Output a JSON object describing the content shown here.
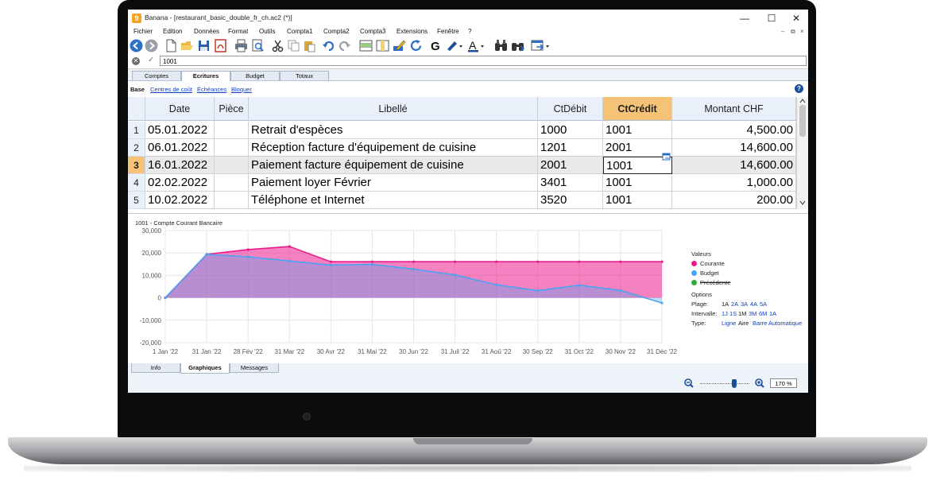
{
  "window": {
    "app_icon": "9",
    "title": "Banana - [restaurant_basic_double_fr_ch.ac2 (*)]",
    "minimize": "—",
    "maximize": "☐",
    "close": "✕"
  },
  "menu": [
    "Fichier",
    "Edition",
    "Données",
    "Format",
    "Outils",
    "Compta1",
    "Compta2",
    "Compta3",
    "Extensions",
    "Fenêtre",
    "?"
  ],
  "mdi_buttons": [
    "–",
    "⧉",
    "×"
  ],
  "toolbar": {
    "icons": [
      "back-icon",
      "forward-icon",
      "new-file-icon",
      "open-folder-icon",
      "save-icon",
      "pdf-icon",
      "print-icon",
      "print-preview-icon",
      "cut-icon",
      "copy-icon",
      "paste-icon",
      "undo-icon",
      "redo-icon",
      "insert-row-icon",
      "add-column-icon",
      "edit-pen-icon",
      "refresh-icon",
      "bold-icon",
      "highlight-color-icon",
      "font-color-icon",
      "find-icon",
      "replace-icon",
      "window-export-icon"
    ],
    "bold_label": "G",
    "font_color_label": "A"
  },
  "editbar": {
    "cancel": "✕",
    "confirm": "✓",
    "value": "1001"
  },
  "tabs": [
    "Comptes",
    "Ecritures",
    "Budget",
    "Totaux"
  ],
  "active_tab": "Ecritures",
  "views": {
    "base": "Base",
    "links": [
      "Centres de coût",
      "Échéances",
      "Bloquer"
    ]
  },
  "help": "?",
  "table": {
    "columns": [
      "Date",
      "Pièce",
      "Libellé",
      "CtDébit",
      "CtCrédit",
      "Montant CHF"
    ],
    "selected_column": "CtCrédit",
    "current_row": 3,
    "rows": [
      {
        "n": "1",
        "date": "05.01.2022",
        "piece": "",
        "libelle": "Retrait d'espèces",
        "debit": "1000",
        "credit": "1001",
        "montant": "4,500.00"
      },
      {
        "n": "2",
        "date": "06.01.2022",
        "piece": "",
        "libelle": "Réception facture d'équipement de cuisine",
        "debit": "1201",
        "credit": "2001",
        "montant": "14,600.00"
      },
      {
        "n": "3",
        "date": "16.01.2022",
        "piece": "",
        "libelle": "Paiement facture équipement de cuisine",
        "debit": "2001",
        "credit": "1001",
        "montant": "14,600.00"
      },
      {
        "n": "4",
        "date": "02.02.2022",
        "piece": "",
        "libelle": "Paiement loyer Février",
        "debit": "3401",
        "credit": "1001",
        "montant": "1,000.00"
      },
      {
        "n": "5",
        "date": "10.02.2022",
        "piece": "",
        "libelle": "Téléphone et Internet",
        "debit": "3520",
        "credit": "1001",
        "montant": "200.00"
      }
    ]
  },
  "chart_data": {
    "type": "area",
    "title": "1001 - Compte Courant Bancaire",
    "categories": [
      "1 Jan '22",
      "31 Jan '22",
      "28 Fév '22",
      "31 Mar '22",
      "30 Avr '22",
      "31 Mai '22",
      "30 Jun '22",
      "31 Juil '22",
      "31 Aoû '22",
      "30 Sep '22",
      "31 Oct '22",
      "30 Nov '22",
      "31 Déc '22"
    ],
    "ylim": [
      -20000,
      30000
    ],
    "yticks": [
      30000,
      20000,
      10000,
      0,
      -10000,
      -20000
    ],
    "ytick_labels": [
      "30,000",
      "20,000",
      "10,000",
      "0",
      "-10,000",
      "-20,000"
    ],
    "grid": true,
    "legend_position": "right",
    "series": [
      {
        "name": "Courante",
        "color": "#ec1b8c",
        "values": [
          0,
          19400,
          21500,
          22900,
          16100,
          16100,
          16100,
          16100,
          16100,
          16100,
          16100,
          16100,
          16100
        ]
      },
      {
        "name": "Budget",
        "color": "#4aa3f0",
        "values": [
          0,
          19400,
          18300,
          16400,
          14600,
          14900,
          12800,
          10200,
          5800,
          3200,
          5600,
          3300,
          -2300
        ]
      },
      {
        "name": "Précédente",
        "color": "#2eaa3a",
        "values": [],
        "struck": true
      }
    ]
  },
  "chart_panel": {
    "legend_title": "Valeurs",
    "options_title": "Options",
    "plage_label": "Plage:",
    "plage_values": [
      "1A",
      "2A",
      "3A",
      "4A",
      "5A"
    ],
    "intervalle_label": "Intervalle:",
    "intervalle_values": [
      "1J",
      "1S",
      "1M",
      "3M",
      "6M",
      "1A"
    ],
    "type_label": "Type:",
    "type_values": [
      "Ligne",
      "Aire",
      "Barre",
      "Automatique"
    ]
  },
  "bottom_tabs": [
    "Info",
    "Graphiques",
    "Messages"
  ],
  "active_bottom_tab": "Graphiques",
  "zoom": {
    "value": "170 %",
    "level": 0.7
  }
}
